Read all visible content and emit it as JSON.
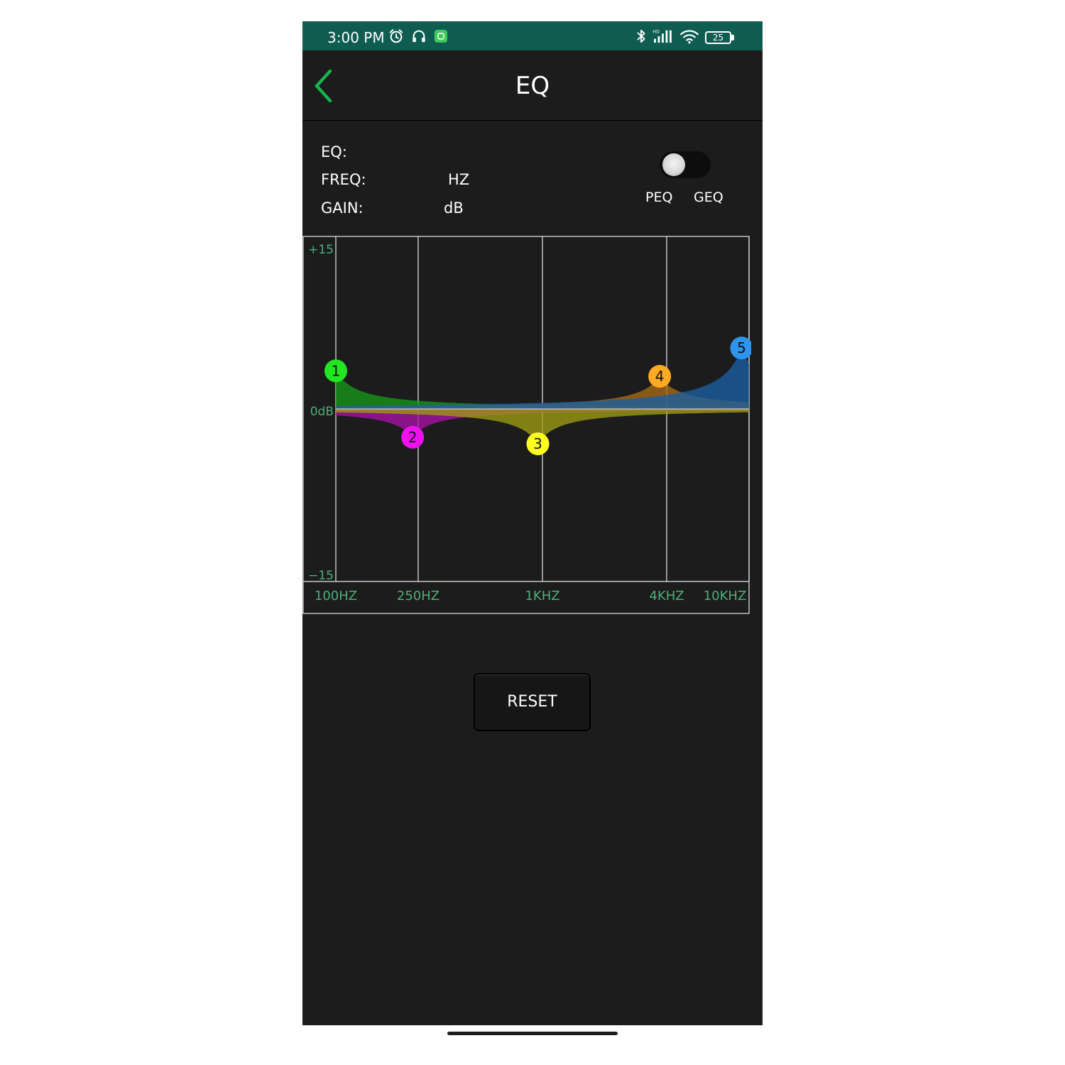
{
  "status_bar": {
    "time": "3:00 PM",
    "battery_level": "25",
    "network_badge": "HD",
    "icons": [
      "alarm-icon",
      "headphones-icon",
      "app-notification-icon",
      "bluetooth-icon",
      "signal-icon",
      "wifi-icon",
      "battery-icon"
    ]
  },
  "header": {
    "title": "EQ",
    "back_icon": "chevron-left-icon"
  },
  "info": {
    "eq_label": "EQ:",
    "eq_value": "",
    "freq_label": "FREQ:",
    "freq_value": "",
    "freq_unit": "HZ",
    "gain_label": "GAIN:",
    "gain_value": "",
    "gain_unit": "dB"
  },
  "mode": {
    "peq_label": "PEQ",
    "geq_label": "GEQ",
    "selected": "PEQ"
  },
  "chart_data": {
    "type": "area",
    "y_labels": {
      "top": "+15",
      "middle": "0dB",
      "bottom": "−15"
    },
    "ylim": [
      -15,
      15
    ],
    "x_ticks": [
      {
        "label": "100HZ",
        "freq": 100
      },
      {
        "label": "250HZ",
        "freq": 250
      },
      {
        "label": "1KHZ",
        "freq": 1000
      },
      {
        "label": "4KHZ",
        "freq": 4000
      },
      {
        "label": "10KHZ",
        "freq": 10000
      }
    ],
    "grid": true,
    "bands": [
      {
        "name": "1",
        "freq": 100,
        "gain": 3.5,
        "color": "#22e622",
        "fill": "#179917"
      },
      {
        "name": "2",
        "freq": 235,
        "gain": -2.6,
        "color": "#ee11ee",
        "fill": "#a612a6"
      },
      {
        "name": "3",
        "freq": 950,
        "gain": -3.2,
        "color": "#ffff22",
        "fill": "#9c9c12"
      },
      {
        "name": "4",
        "freq": 3700,
        "gain": 3.0,
        "color": "#ffaa22",
        "fill": "#a96a14"
      },
      {
        "name": "5",
        "freq": 9200,
        "gain": 5.6,
        "color": "#2f94ee",
        "fill": "#1a5fa3"
      }
    ],
    "axis_color": "#4caf78",
    "grid_color": "#e8e8e8"
  },
  "reset": {
    "label": "RESET"
  }
}
